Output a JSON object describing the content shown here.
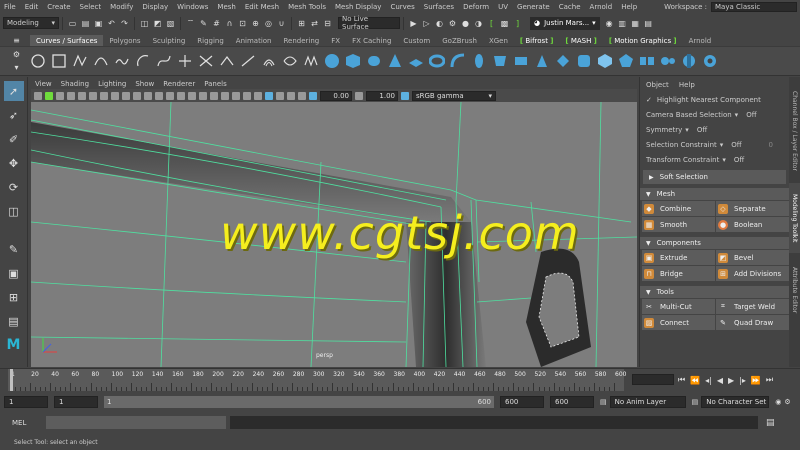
{
  "menubar": {
    "items": [
      "File",
      "Edit",
      "Create",
      "Select",
      "Modify",
      "Display",
      "Windows",
      "Mesh",
      "Edit Mesh",
      "Mesh Tools",
      "Mesh Display",
      "Curves",
      "Surfaces",
      "Deform",
      "UV",
      "Generate",
      "Cache",
      "Arnold",
      "Help"
    ],
    "workspace_label": "Workspace :",
    "workspace_value": "Maya Classic"
  },
  "statusline": {
    "mode": "Modeling",
    "live_surface": "No Live Surface",
    "user": "Justin Mars..."
  },
  "shelf_tabs": [
    "Curves / Surfaces",
    "Polygons",
    "Sculpting",
    "Rigging",
    "Animation",
    "Rendering",
    "FX",
    "FX Caching",
    "Custom",
    "GoZBrush",
    "XGen",
    "Bifrost",
    "MASH",
    "Motion Graphics",
    "Arnold"
  ],
  "shelf_bracket_tabs": [
    "Bifrost",
    "MASH",
    "Motion Graphics"
  ],
  "panel_menu": [
    "View",
    "Shading",
    "Lighting",
    "Show",
    "Renderer",
    "Panels"
  ],
  "panel_toolbar": {
    "exposure": "0.00",
    "gamma": "1.00",
    "color_space": "sRGB gamma"
  },
  "viewport": {
    "camera_label": "persp",
    "watermark": "www.cgtsj.com"
  },
  "modeling_toolkit": {
    "menu": [
      "Object",
      "Help"
    ],
    "highlight_nearest": "Highlight Nearest Component",
    "camera_based_selection": {
      "label": "Camera Based Selection",
      "value": "Off"
    },
    "symmetry": {
      "label": "Symmetry",
      "value": "Off"
    },
    "selection_constraint": {
      "label": "Selection Constraint",
      "value": "Off",
      "extra": "0"
    },
    "transform_constraint": {
      "label": "Transform Constraint",
      "value": "Off"
    },
    "soft_selection": "Soft Selection",
    "sections": [
      {
        "title": "Mesh",
        "buttons": [
          "Combine",
          "Separate",
          "Smooth",
          "Boolean"
        ]
      },
      {
        "title": "Components",
        "buttons": [
          "Extrude",
          "Bevel",
          "Bridge",
          "Add Divisions"
        ]
      },
      {
        "title": "Tools",
        "buttons": [
          "Multi-Cut",
          "Target Weld",
          "Connect",
          "Quad Draw"
        ]
      }
    ]
  },
  "side_tabs": [
    "Channel Box / Layer Editor",
    "Modeling Toolkit",
    "Attribute Editor"
  ],
  "timeline": {
    "ticks": [
      "1",
      "20",
      "40",
      "60",
      "80",
      "100",
      "120",
      "140",
      "160",
      "180",
      "200",
      "220",
      "240",
      "260",
      "280",
      "300",
      "320",
      "340",
      "360",
      "380",
      "400",
      "420",
      "440",
      "460",
      "480",
      "500",
      "520",
      "540",
      "560",
      "580",
      "600"
    ],
    "current_frame": "1"
  },
  "range": {
    "start": "1",
    "playback_start": "1",
    "slider_start": "1",
    "slider_end": "600",
    "playback_end": "600",
    "end": "600",
    "anim_layer": "No Anim Layer",
    "char_set": "No Character Set"
  },
  "command_line": {
    "label": "MEL"
  },
  "help_line": "Select Tool: select an object",
  "colors": {
    "accent_green": "#6fdc3c",
    "wire_green": "#4fe0a0",
    "watermark_yellow": "#f5ee1e",
    "selection_blue": "#5285a6"
  }
}
